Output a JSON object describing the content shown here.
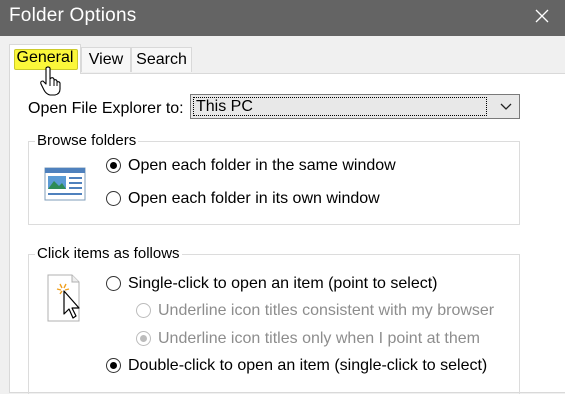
{
  "window": {
    "title": "Folder Options"
  },
  "tabs": [
    {
      "label": "General"
    },
    {
      "label": "View"
    },
    {
      "label": "Search"
    }
  ],
  "general": {
    "open_label": "Open File Explorer to:",
    "open_value": "This PC",
    "browse": {
      "legend": "Browse folders",
      "options": [
        {
          "label": "Open each folder in the same window",
          "checked": true
        },
        {
          "label": "Open each folder in its own window",
          "checked": false
        }
      ]
    },
    "click": {
      "legend": "Click items as follows",
      "options": [
        {
          "label": "Single-click to open an item (point to select)",
          "checked": false
        },
        {
          "label": "Underline icon titles consistent with my browser",
          "checked": false,
          "disabled": true
        },
        {
          "label": "Underline icon titles only when I point at them",
          "checked": true,
          "disabled": true
        },
        {
          "label": "Double-click to open an item (single-click to select)",
          "checked": true
        }
      ]
    }
  },
  "colors": {
    "titlebar": "#646464",
    "tab_highlight": "#fbf73a"
  },
  "icons": [
    "close-icon",
    "chevron-down-icon",
    "hand-pointer-icon",
    "folder-window-icon",
    "click-cursor-icon"
  ]
}
